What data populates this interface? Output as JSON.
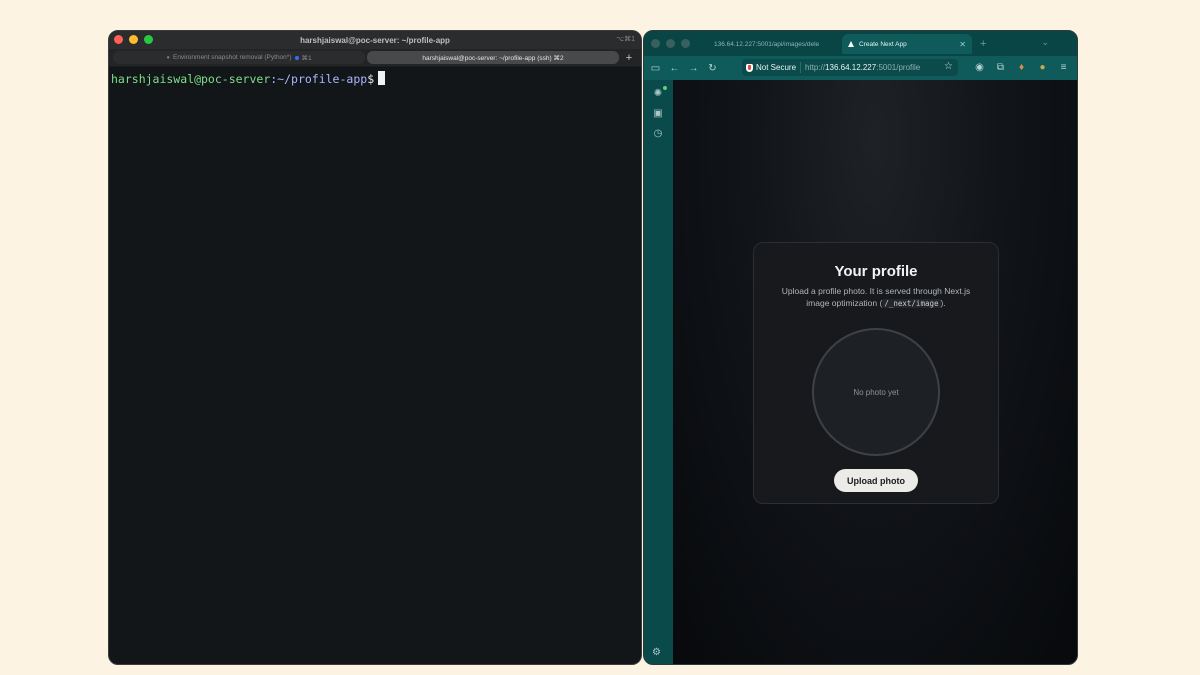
{
  "terminal": {
    "title": "harshjaiswal@poc-server: ~/profile-app",
    "shortcut": "⌥⌘1",
    "tabs": [
      {
        "label": "Environment snapshot removal (Python*)",
        "shortcut": "⌘1"
      },
      {
        "label": "harshjaiswal@poc-server: ~/profile-app (ssh) ⌘2"
      }
    ],
    "new_tab": "+",
    "prompt": {
      "user_host": "harshjaiswal@poc-server",
      "path": ":~/profile-app",
      "symbol": "$"
    }
  },
  "browser": {
    "tabs": [
      {
        "label": "136.64.12.227:5001/api/images/dele"
      },
      {
        "label": "Create Next App"
      }
    ],
    "new_tab": "+",
    "security_label": "Not Secure",
    "url": {
      "scheme": "http://",
      "host": "136.64.12.227",
      "rest": ":5001/profile"
    },
    "page": {
      "title": "Your profile",
      "description_before": "Upload a profile photo. It is served through Next.js image optimization (",
      "description_code": "/_next/image",
      "description_after": ").",
      "placeholder": "No photo yet",
      "upload_label": "Upload photo"
    }
  },
  "colors": {
    "background": "#fcf3e3",
    "terminal_bg": "#131619",
    "browser_chrome": "#0f5a5a",
    "prompt_green": "#7ddf8a"
  }
}
